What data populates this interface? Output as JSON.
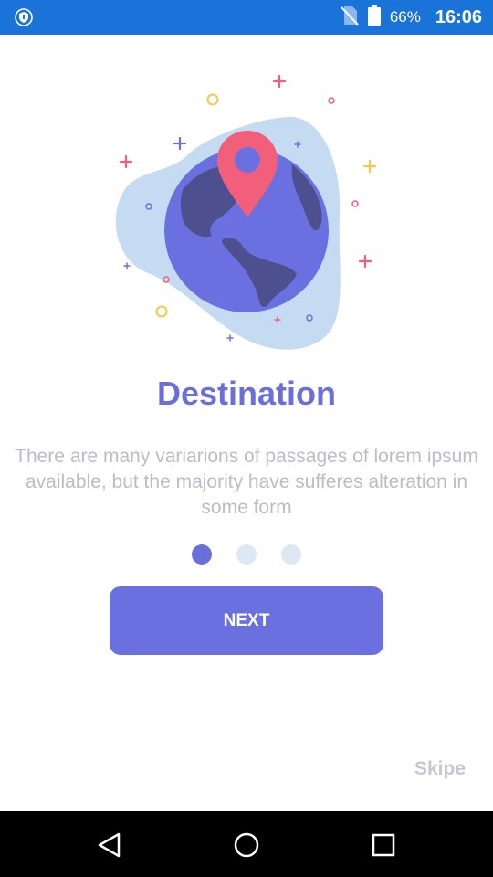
{
  "status_bar": {
    "battery_percent": "66%",
    "time": "16:06",
    "icons": [
      "shield-icon",
      "no-sim-icon",
      "battery-icon"
    ]
  },
  "onboarding": {
    "title": "Destination",
    "description": "There are many variarions of passages of lorem ipsum available, but the majority have sufferes alteration in some form",
    "page_count": 3,
    "current_page": 1,
    "next_label": "NEXT",
    "skip_label": "Skipe"
  },
  "colors": {
    "accent": "#6b70e0",
    "title": "#6b70d9",
    "status_bar": "#1a73d9",
    "pin": "#f25f7a"
  },
  "nav_bar": {
    "icons": [
      "back-icon",
      "home-icon",
      "recents-icon"
    ]
  }
}
